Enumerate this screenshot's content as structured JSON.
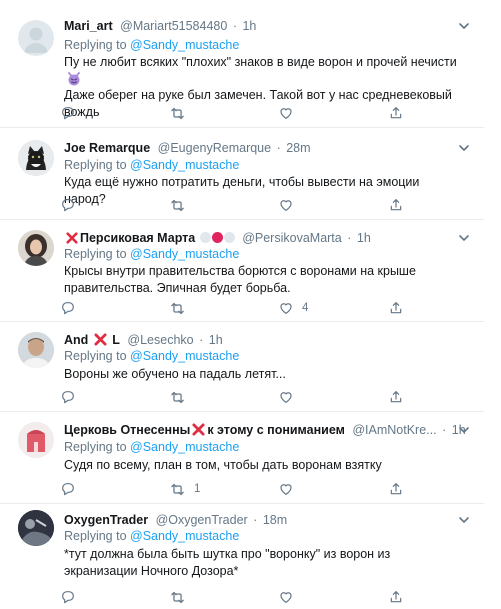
{
  "tweets": [
    {
      "name": "Mari_art",
      "handle": "@Mariart51584480",
      "time": "1h",
      "reply_prefix": "Replying to ",
      "reply_to": "@Sandy_mustache",
      "text": "Пу не любит всяких \"плохих\" знаков в виде ворон и прочей нечисти",
      "text2": "Даже оберег на руке был замечен. Такой вот у нас средневековый вождь",
      "icon": "devil-emoji"
    },
    {
      "name": "Joe Remarque",
      "handle": "@EugenyRemarque",
      "time": "28m",
      "reply_prefix": "Replying to ",
      "reply_to": "@Sandy_mustache",
      "text": "Куда ещё нужно потратить деньги, чтобы вывести на эмоции народ?"
    },
    {
      "name": "Персиковая Марта",
      "handle": "@PersikovaMarta",
      "time": "1h",
      "reply_prefix": "Replying to ",
      "reply_to": "@Sandy_mustache",
      "text": "Крысы внутри правительства борются с воронами на крыше правительства. Эпичная будет борьба.",
      "like_count": "4"
    },
    {
      "name_a": "And",
      "name_b": "L",
      "handle": "@Lesechko",
      "time": "1h",
      "reply_prefix": "Replying to ",
      "reply_to": "@Sandy_mustache",
      "text": "Вороны же обучено на падаль летят..."
    },
    {
      "name_a": "Церковь Отнесенны",
      "name_b": "к этому с пониманием",
      "handle": "@IAmNotKre...",
      "time": "1h",
      "reply_prefix": "Replying to ",
      "reply_to": "@Sandy_mustache",
      "text": "Судя по всему, план в том, чтобы дать воронам взятку",
      "retweet_count": "1"
    },
    {
      "name": "OxygenTrader",
      "handle": "@OxygenTrader",
      "time": "18m",
      "reply_prefix": "Replying to ",
      "reply_to": "@Sandy_mustache",
      "text": "*тут должна была быть шутка про \"воронку\" из ворон из экранизации Ночного Дозора*"
    }
  ],
  "colors": {
    "link": "#1da1f2",
    "muted": "#657786",
    "divider": "#e6ecf0",
    "red_x": "#dd2e44"
  }
}
